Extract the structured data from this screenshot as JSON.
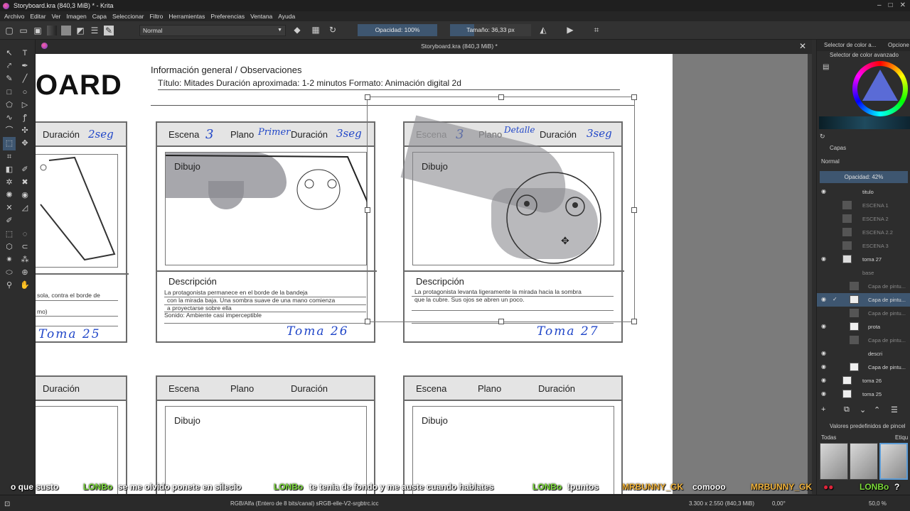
{
  "window": {
    "title": "Storyboard.kra (840,3 MiB) * - Krita",
    "buttons": [
      "–",
      "□",
      "✕"
    ]
  },
  "menu": [
    "Archivo",
    "Editar",
    "Ver",
    "Imagen",
    "Capa",
    "Seleccionar",
    "Filtro",
    "Herramientas",
    "Preferencias",
    "Ventana",
    "Ayuda"
  ],
  "toolbar": {
    "blend_mode": "Normal",
    "opacity": "Opacidad: 100%",
    "size": "Tamaño: 36,33 px"
  },
  "document": {
    "tab_title": "Storyboard.kra (840,3 MiB) *"
  },
  "storyboard": {
    "title_fragment": "OARD",
    "info_heading": "Información general / Observaciones",
    "info_line": "Título: Mitades Duración aproximada: 1-2 minutos Formato: Animación digital 2d",
    "labels": {
      "escena": "Escena",
      "plano": "Plano",
      "duracion": "Duración",
      "dibujo": "Dibujo",
      "descripcion": "Descripción"
    },
    "panels": [
      {
        "escena": "",
        "plano": "",
        "duracion": "2seg",
        "desc_lines": [
          "sola, contra el borde de",
          "mo)"
        ],
        "toma": "Toma 25"
      },
      {
        "escena": "3",
        "plano": "Primer",
        "duracion": "3seg",
        "desc_lines": [
          "La protagonista permanece en el borde de la bandeja",
          "con la mirada baja. Una sombra suave de una mano comienza",
          "a proyectarse sobre ella",
          "Sonido: Ambiente casi imperceptible"
        ],
        "toma": "Toma 26"
      },
      {
        "escena": "3",
        "plano": "Detalle",
        "duracion": "3seg",
        "desc_lines": [
          "La protagonista levanta ligeramente la mirada hacia la sombra",
          "que la cubre. Sus ojos se abren un poco."
        ],
        "toma": "Toma 27"
      }
    ]
  },
  "chat": [
    {
      "user": "",
      "msg": "o que susto"
    },
    {
      "user": "LONBo",
      "msg": "se me olvido ponete en silecio"
    },
    {
      "user": "LONBo",
      "msg": "te tenia de fondo y me auste cuando hablates"
    },
    {
      "user": "LONBo",
      "msg": "!puntos"
    },
    {
      "user": "MRBUNNY_GK",
      "msg": "comooo"
    },
    {
      "user": "MRBUNNY_GK",
      "msg": ""
    },
    {
      "user": "LONBo",
      "msg": "?"
    }
  ],
  "status": {
    "colorspace": "RGB/Alfa (Entero de 8 bits/canal)  sRGB-elle-V2-srgbtrc.icc",
    "dims": "3.300 x 2.550 (840,3 MiB)",
    "rotation": "0,00°",
    "zoom": "50,0 %"
  },
  "dock": {
    "tabs": [
      "Selector de color a...",
      "Opcione"
    ],
    "color_label": "Selector de color avanzado",
    "layers_label": "Capas",
    "layer_blend": "Normal",
    "layer_opacity": "Opacidad: 42%",
    "layers": [
      "titulo",
      "ESCENA 1",
      "ESCENA 2",
      "ESCENA 2.2",
      "ESCENA 3",
      "toma 27",
      "base",
      "Capa de pintu...",
      "Capa de pintu...",
      "Capa de pintu...",
      "prota",
      "Capa de pintu...",
      "descri",
      "Capa de pintu...",
      "toma 26",
      "toma 25"
    ],
    "brush_label": "Valores predefinidos de pincel",
    "brush_filter": "Todas",
    "brush_tag": "Etiqu"
  }
}
